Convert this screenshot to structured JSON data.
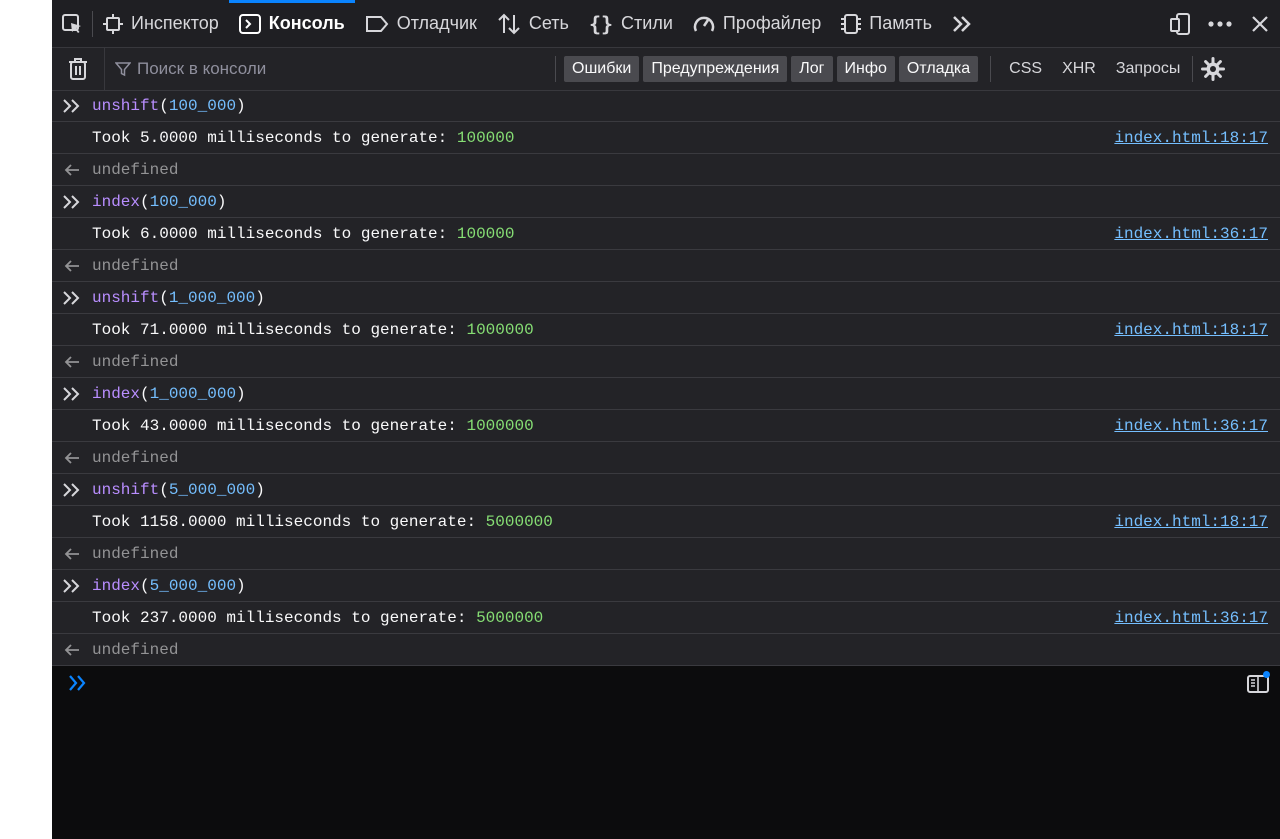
{
  "toolbar": {
    "tabs": [
      {
        "label": "Инспектор",
        "icon": "inspector-icon"
      },
      {
        "label": "Консоль",
        "icon": "console-icon",
        "active": true
      },
      {
        "label": "Отладчик",
        "icon": "debugger-icon"
      },
      {
        "label": "Сеть",
        "icon": "network-icon"
      },
      {
        "label": "Стили",
        "icon": "style-editor-icon"
      },
      {
        "label": "Профайлер",
        "icon": "profiler-icon"
      },
      {
        "label": "Память",
        "icon": "memory-icon"
      }
    ]
  },
  "filter": {
    "placeholder": "Поиск в консоли",
    "levels": [
      "Ошибки",
      "Предупреждения",
      "Лог",
      "Инфо",
      "Отладка"
    ],
    "requests": [
      "CSS",
      "XHR",
      "Запросы"
    ]
  },
  "messages": [
    {
      "fn": "unshift",
      "arg": "100_000"
    },
    {
      "prefix": "Took 5.0000 milliseconds to generate: ",
      "value": "100000",
      "source": "index.html:18:17"
    },
    {
      "result": "undefined"
    },
    {
      "fn": "index",
      "arg": "100_000"
    },
    {
      "prefix": "Took 6.0000 milliseconds to generate: ",
      "value": "100000",
      "source": "index.html:36:17"
    },
    {
      "result": "undefined"
    },
    {
      "fn": "unshift",
      "arg": "1_000_000"
    },
    {
      "prefix": "Took 71.0000 milliseconds to generate: ",
      "value": "1000000",
      "source": "index.html:18:17"
    },
    {
      "result": "undefined"
    },
    {
      "fn": "index",
      "arg": "1_000_000"
    },
    {
      "prefix": "Took 43.0000 milliseconds to generate: ",
      "value": "1000000",
      "source": "index.html:36:17"
    },
    {
      "result": "undefined"
    },
    {
      "fn": "unshift",
      "arg": "5_000_000"
    },
    {
      "prefix": "Took 1158.0000 milliseconds to generate: ",
      "value": "5000000",
      "source": "index.html:18:17"
    },
    {
      "result": "undefined"
    },
    {
      "fn": "index",
      "arg": "5_000_000"
    },
    {
      "prefix": "Took 237.0000 milliseconds to generate: ",
      "value": "5000000",
      "source": "index.html:36:17"
    },
    {
      "result": "undefined"
    }
  ],
  "colors": {
    "accent": "#0a84ff",
    "function": "#b98eff",
    "number": "#75bfff",
    "string_value": "#86de74"
  }
}
